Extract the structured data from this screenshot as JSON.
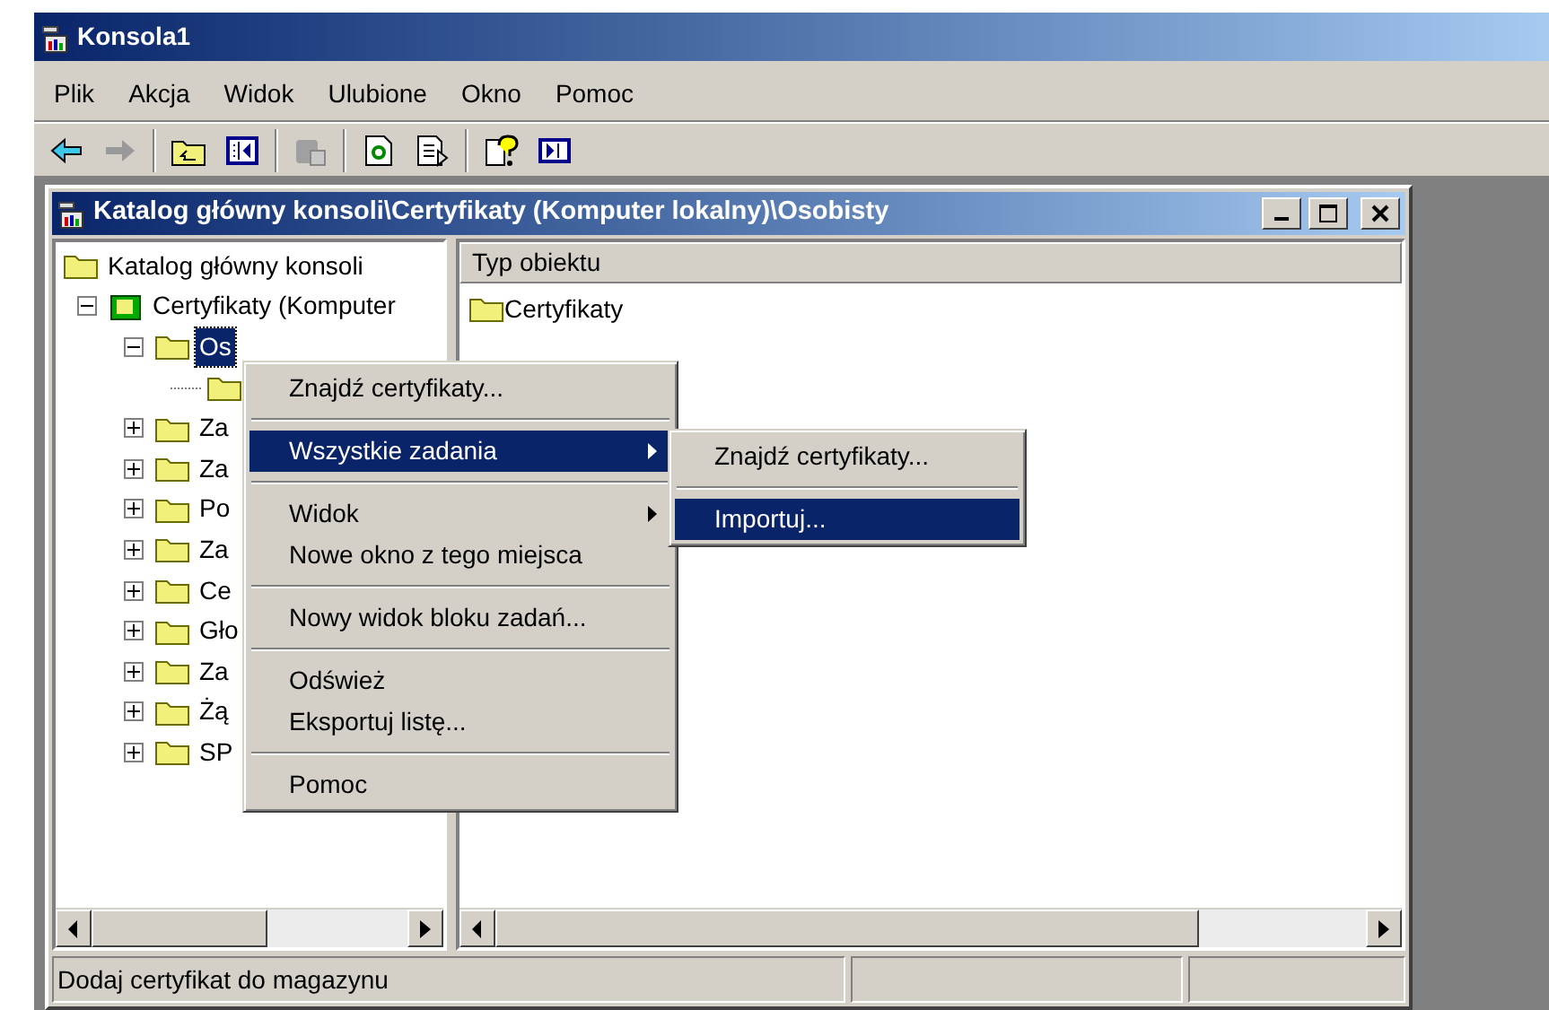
{
  "window": {
    "title": "Konsola1"
  },
  "menu_bar": [
    {
      "label": "Plik"
    },
    {
      "label": "Akcja"
    },
    {
      "label": "Widok"
    },
    {
      "label": "Ulubione"
    },
    {
      "label": "Okno"
    },
    {
      "label": "Pomoc"
    }
  ],
  "child_window": {
    "title": "Katalog główny konsoli\\Certyfikaty (Komputer lokalny)\\Osobisty"
  },
  "tree": [
    {
      "label": "Katalog główny konsoli",
      "selected": false,
      "children": [
        {
          "label": "Certyfikaty (Komputer",
          "expanded": true,
          "selected": false,
          "children": [
            {
              "label": "Os",
              "expanded": true,
              "selected": true,
              "children": [
                {
                  "selected": false
                }
              ]
            },
            {
              "label": "Za",
              "expanded": false,
              "selected": false
            },
            {
              "label": "Za",
              "expanded": false,
              "selected": false
            },
            {
              "label": "Po",
              "expanded": false,
              "selected": false
            },
            {
              "label": "Za",
              "expanded": false,
              "selected": false
            },
            {
              "label": "Ce",
              "expanded": false,
              "selected": false
            },
            {
              "label": "Gło",
              "expanded": false,
              "selected": false
            },
            {
              "label": "Za",
              "expanded": false,
              "selected": false
            },
            {
              "label": "Żą",
              "expanded": false,
              "selected": false
            },
            {
              "label": "SP",
              "expanded": false,
              "selected": false
            }
          ]
        }
      ]
    }
  ],
  "list": {
    "columns": [
      "Typ obiektu"
    ],
    "rows": [
      "Certyfikaty"
    ]
  },
  "context_menu": {
    "items": [
      {
        "kind": "item",
        "label": "Znajdź certyfikaty...",
        "selected": false
      },
      {
        "kind": "separator"
      },
      {
        "kind": "submenu",
        "label": "Wszystkie zadania",
        "selected": true
      },
      {
        "kind": "separator"
      },
      {
        "kind": "submenu",
        "label": "Widok",
        "selected": false
      },
      {
        "kind": "item",
        "label": "Nowe okno z tego miejsca",
        "selected": false
      },
      {
        "kind": "separator"
      },
      {
        "kind": "item",
        "label": "Nowy widok bloku zadań...",
        "selected": false
      },
      {
        "kind": "separator"
      },
      {
        "kind": "item",
        "label": "Odśwież",
        "selected": false
      },
      {
        "kind": "item",
        "label": "Eksportuj listę...",
        "selected": false
      },
      {
        "kind": "separator"
      },
      {
        "kind": "item",
        "label": "Pomoc",
        "selected": false
      }
    ]
  },
  "submenu": {
    "items": [
      {
        "kind": "item",
        "label": "Znajdź certyfikaty...",
        "selected": false
      },
      {
        "kind": "separator"
      },
      {
        "kind": "item",
        "label": "Importuj...",
        "selected": true
      }
    ]
  },
  "status_bar": [
    "Dodaj certyfikat do magazynu"
  ]
}
